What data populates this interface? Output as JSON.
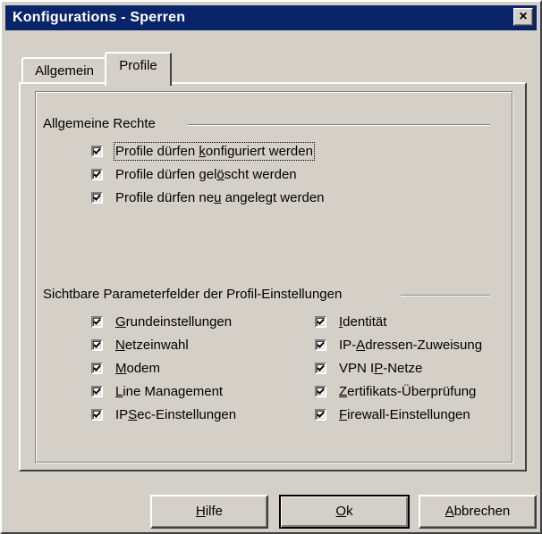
{
  "window": {
    "title": "Konfigurations - Sperren",
    "close_glyph": "×"
  },
  "tabs": [
    {
      "label": "Allgemein",
      "active": false
    },
    {
      "label": "Profile",
      "active": true
    }
  ],
  "group_rights": {
    "title": "Allgemeine Rechte",
    "items": [
      {
        "pre": "Profile dürfen ",
        "key": "k",
        "post": "onfiguriert werden",
        "checked": true
      },
      {
        "pre": "Profile dürfen gel",
        "key": "ö",
        "post": "scht werden",
        "checked": true
      },
      {
        "pre": "Profile dürfen ne",
        "key": "u",
        "post": " angelegt werden",
        "checked": true
      }
    ]
  },
  "group_fields": {
    "title": "Sichtbare Parameterfelder der Profil-Einstellungen",
    "left": [
      {
        "pre": "",
        "key": "G",
        "post": "rundeinstellungen",
        "checked": true
      },
      {
        "pre": "",
        "key": "N",
        "post": "etzeinwahl",
        "checked": true
      },
      {
        "pre": "",
        "key": "M",
        "post": "odem",
        "checked": true
      },
      {
        "pre": "",
        "key": "L",
        "post": "ine Management",
        "checked": true
      },
      {
        "pre": "IP",
        "key": "S",
        "post": "ec-Einstellungen",
        "checked": true
      }
    ],
    "right": [
      {
        "pre": "",
        "key": "I",
        "post": "dentität",
        "checked": true
      },
      {
        "pre": "IP-",
        "key": "A",
        "post": "dressen-Zuweisung",
        "checked": true
      },
      {
        "pre": "VPN I",
        "key": "P",
        "post": "-Netze",
        "checked": true
      },
      {
        "pre": "",
        "key": "Z",
        "post": "ertifikats-Überprüfung",
        "checked": true
      },
      {
        "pre": "",
        "key": "F",
        "post": "irewall-Einstellungen",
        "checked": true
      }
    ]
  },
  "buttons": {
    "help": {
      "pre": "",
      "key": "H",
      "post": "ilfe"
    },
    "ok": {
      "pre": "",
      "key": "O",
      "post": "k"
    },
    "cancel": {
      "pre": "",
      "key": "A",
      "post": "bbrechen"
    }
  }
}
